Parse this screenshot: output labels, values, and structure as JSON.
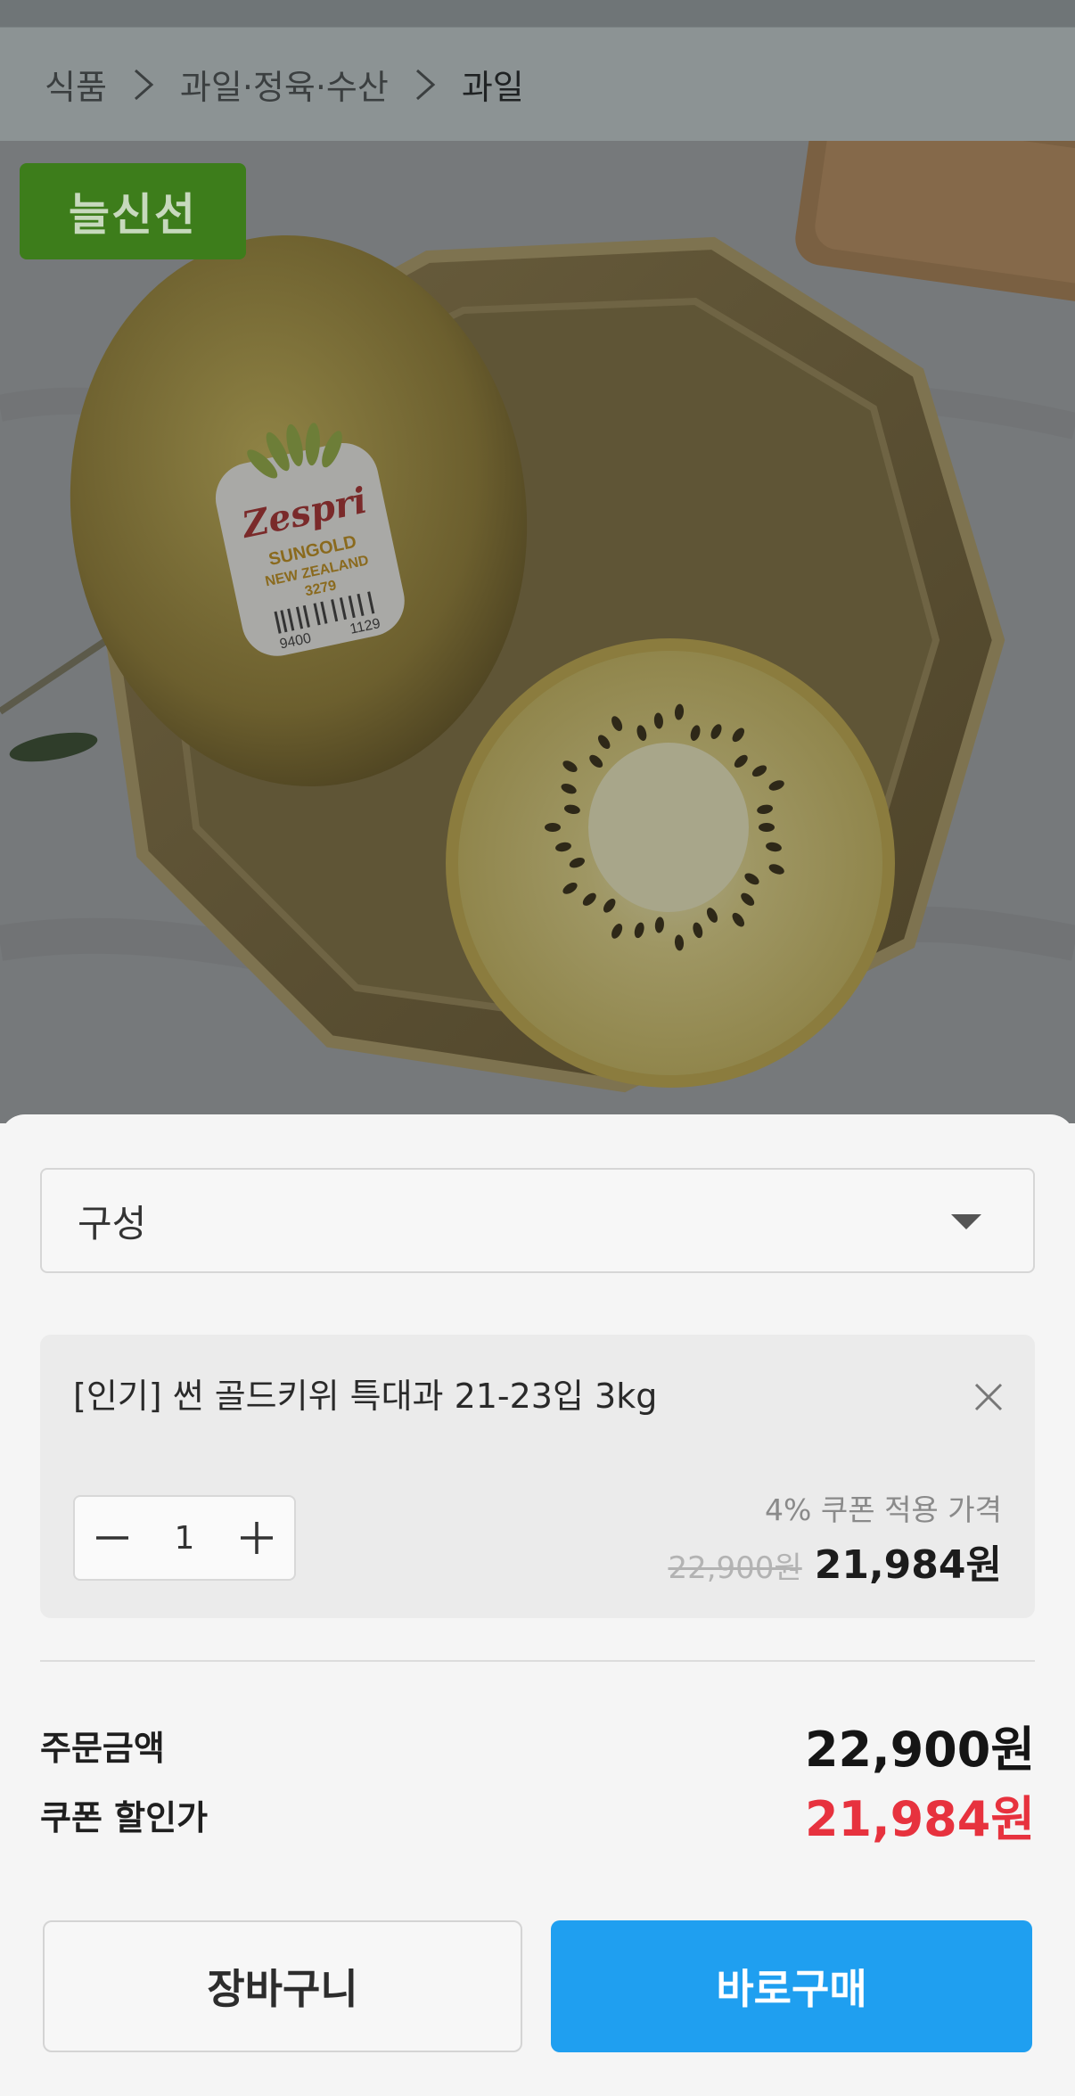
{
  "breadcrumb": {
    "items": [
      "식품",
      "과일·정육·수산",
      "과일"
    ]
  },
  "product": {
    "badge": "늘신선",
    "sticker": {
      "brand": "Zespri",
      "line1": "SUNGOLD",
      "line2": "NEW ZEALAND",
      "code": "3279",
      "barcode_left": "9400",
      "barcode_right": "1129"
    }
  },
  "options": {
    "select_label": "구성",
    "selected": {
      "name": "[인기] 썬 골드키위 특대과 21-23입 3kg",
      "quantity": "1",
      "coupon_label": "4% 쿠폰 적용 가격",
      "original_price": "22,900원",
      "sale_price": "21,984원"
    }
  },
  "summary": {
    "order_amount_label": "주문금액",
    "order_amount": "22,900원",
    "coupon_price_label": "쿠폰 할인가",
    "coupon_price": "21,984원"
  },
  "actions": {
    "cart": "장바구니",
    "buy_now": "바로구매"
  },
  "colors": {
    "accent_blue": "#1f9ff0",
    "discount_red": "#e7323e",
    "badge_green": "#3d7d1b"
  }
}
